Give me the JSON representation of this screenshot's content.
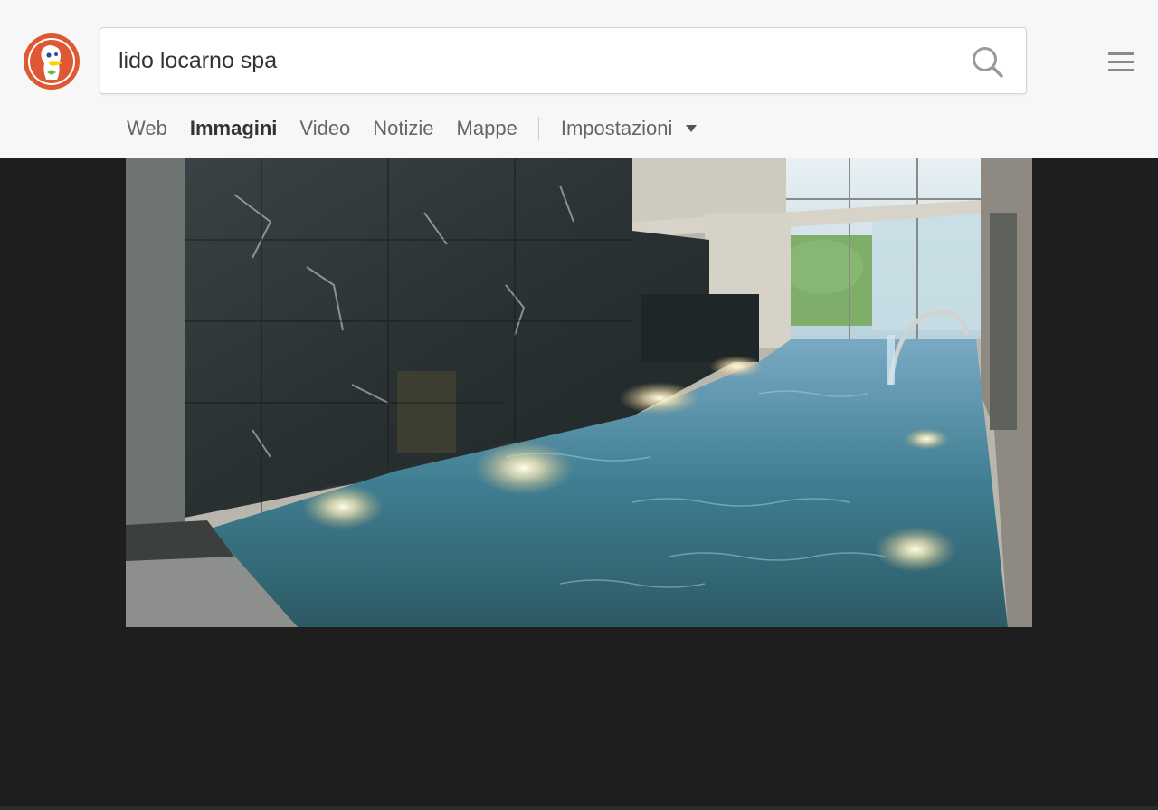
{
  "search": {
    "query": "lido locarno spa"
  },
  "nav": {
    "items": [
      {
        "label": "Web",
        "active": false
      },
      {
        "label": "Immagini",
        "active": true
      },
      {
        "label": "Video",
        "active": false
      },
      {
        "label": "Notizie",
        "active": false
      },
      {
        "label": "Mappe",
        "active": false
      }
    ],
    "settings_label": "Impostazioni"
  },
  "icons": {
    "logo": "duckduckgo-logo",
    "search": "search-icon",
    "menu": "hamburger-menu-icon",
    "settings": "caret-down-icon"
  },
  "colors": {
    "header_bg": "#f7f7f7",
    "viewer_bg": "#1e1e1e",
    "logo_orange": "#de5833"
  }
}
